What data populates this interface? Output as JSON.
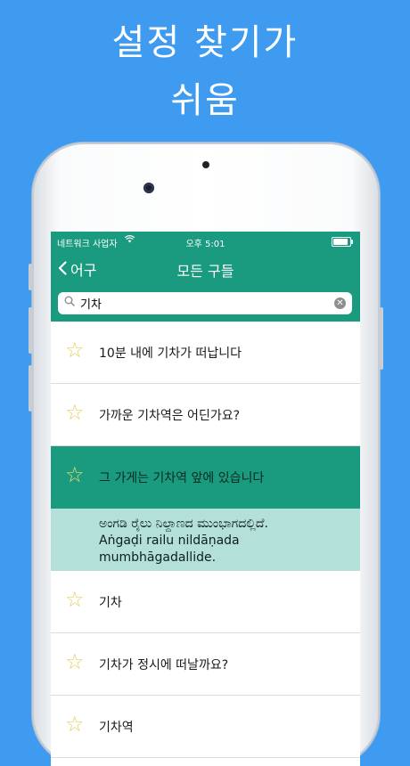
{
  "promo": {
    "line1": "설정 찾기가",
    "line2": "쉬움"
  },
  "status": {
    "carrier": "네트워크 사업자",
    "time": "오후 5:01",
    "battery_level": 0.9
  },
  "nav": {
    "back_label": "어구",
    "title": "모든 구들"
  },
  "search": {
    "value": "기차",
    "placeholder": ""
  },
  "rows": [
    {
      "phrase": "10분 내에 기차가 떠납니다"
    },
    {
      "phrase": "가까운 기차역은 어딘가요?"
    },
    {
      "phrase": "그 가게는 기차역 앞에 있습니다"
    },
    {
      "phrase": "기차"
    },
    {
      "phrase": "기차가 정시에 떠날까요?"
    },
    {
      "phrase": "기차역"
    }
  ],
  "translation": {
    "native": "ಅಂಗಡಿ ರೈಲು ನಿಲ್ದಾಣದ ಮುಂಭಾಗದಲ್ಲಿದೆ.",
    "roman_1": "Aṅgaḍi railu nildāṇada",
    "roman_2": "mumbhāgadallide."
  },
  "colors": {
    "background": "#3f9bf0",
    "accent": "#1a9a7e",
    "highlight": "#b4e0da",
    "star": "#e8cf5e"
  },
  "icons": {
    "back": "chevron-left-icon",
    "search": "magnifier-icon",
    "clear": "clear-x-icon",
    "favorite": "star-outline-icon",
    "wifi": "wifi-icon",
    "battery": "battery-icon"
  }
}
